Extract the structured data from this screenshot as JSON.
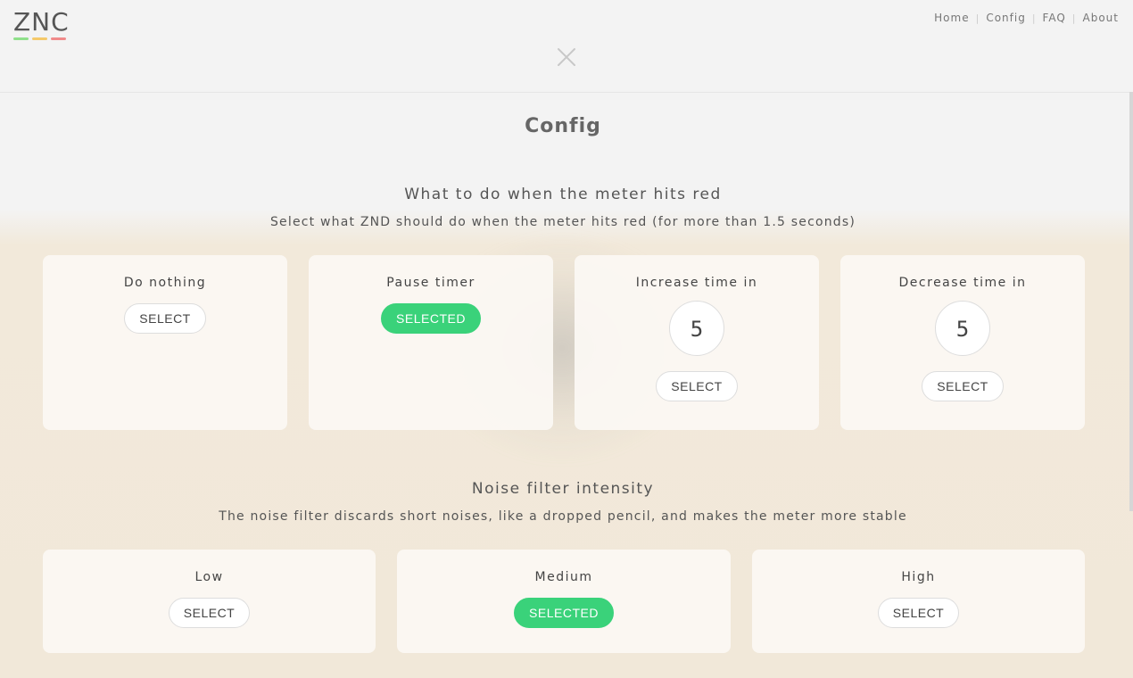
{
  "header": {
    "logo": "ZNC",
    "logo_colors": [
      "#8fe08a",
      "#f5c96a",
      "#f08a8a"
    ],
    "nav": [
      "Home",
      "Config",
      "FAQ",
      "About"
    ],
    "close_icon": "close-icon"
  },
  "page": {
    "title": "Config"
  },
  "meter_section": {
    "title": "What to do when the meter hits red",
    "subtitle": "Select what ZND should do when the meter hits red (for more than 1.5 seconds)",
    "options": [
      {
        "label": "Do nothing",
        "button": "SELECT"
      },
      {
        "label": "Pause timer",
        "button": "SELECTED"
      },
      {
        "label": "Increase time in",
        "value": "5",
        "button": "SELECT"
      },
      {
        "label": "Decrease time in",
        "value": "5",
        "button": "SELECT"
      }
    ]
  },
  "noise_section": {
    "title": "Noise filter intensity",
    "subtitle": "The noise filter discards short noises, like a dropped pencil, and makes the meter more stable",
    "options": [
      {
        "label": "Low",
        "button": "SELECT"
      },
      {
        "label": "Medium",
        "button": "SELECTED"
      },
      {
        "label": "High",
        "button": "SELECT"
      }
    ]
  },
  "colors": {
    "selected": "#3ad27a"
  }
}
